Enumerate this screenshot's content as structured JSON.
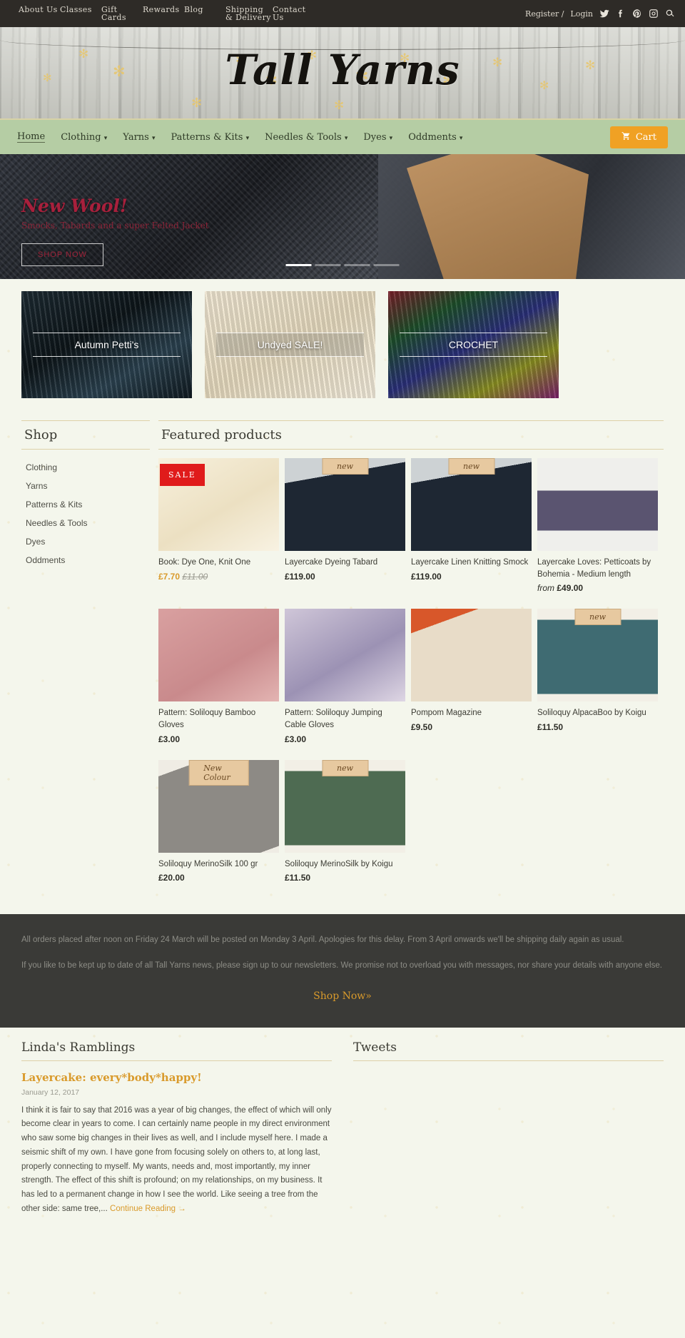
{
  "topbar": {
    "nav": [
      {
        "label": "About Us"
      },
      {
        "label": "Classes"
      },
      {
        "label": "Gift Cards"
      },
      {
        "label": "Rewards"
      },
      {
        "label": "Blog"
      },
      {
        "label": "Shipping & Delivery"
      },
      {
        "label": "Contact Us"
      }
    ],
    "register": "Register /",
    "login": "Login",
    "icons": [
      "twitter-icon",
      "facebook-icon",
      "pinterest-icon",
      "instagram-icon",
      "search-icon"
    ]
  },
  "brand": {
    "name": "Tall Yarns"
  },
  "mainnav": {
    "items": [
      {
        "label": "Home",
        "caret": false,
        "active": true
      },
      {
        "label": "Clothing",
        "caret": true
      },
      {
        "label": "Yarns",
        "caret": true
      },
      {
        "label": "Patterns & Kits",
        "caret": true
      },
      {
        "label": "Needles & Tools",
        "caret": true
      },
      {
        "label": "Dyes",
        "caret": true
      },
      {
        "label": "Oddments",
        "caret": true
      }
    ],
    "cart": "Cart"
  },
  "hero": {
    "title": "New Wool!",
    "subtitle": "Smocks, Tabards and a super Felted Jacket",
    "button": "SHOP NOW",
    "slides": 4,
    "active_slide": 1
  },
  "tiles": [
    {
      "label": "Autumn Petti's"
    },
    {
      "label": "Undyed SALE!"
    },
    {
      "label": "CROCHET"
    }
  ],
  "sidebar": {
    "title": "Shop",
    "items": [
      {
        "label": "Clothing"
      },
      {
        "label": "Yarns"
      },
      {
        "label": "Patterns & Kits"
      },
      {
        "label": "Needles & Tools"
      },
      {
        "label": "Dyes"
      },
      {
        "label": "Oddments"
      }
    ]
  },
  "featured": {
    "title": "Featured products",
    "products": [
      {
        "name": "Book: Dye One, Knit One",
        "price": "£7.70",
        "old_price": "£11.00",
        "badge": "SALE",
        "tone": "cream"
      },
      {
        "name": "Layercake Dyeing Tabard",
        "price": "£119.00",
        "badge": "new",
        "tone": "navy"
      },
      {
        "name": "Layercake Linen Knitting Smock",
        "price": "£119.00",
        "badge": "new",
        "tone": "navy"
      },
      {
        "name": "Layercake Loves: Petticoats by Bohemia - Medium length",
        "price": "£49.00",
        "price_prefix": "from",
        "tone": "skirt"
      },
      {
        "name": "Pattern: Soliloquy Bamboo Gloves",
        "price": "£3.00",
        "tone": "pink"
      },
      {
        "name": "Pattern: Soliloquy Jumping Cable Gloves",
        "price": "£3.00",
        "tone": "lilac"
      },
      {
        "name": "Pompom Magazine",
        "price": "£9.50",
        "tone": "mag"
      },
      {
        "name": "Soliloquy AlpacaBoo by Koigu",
        "price": "£11.50",
        "badge": "new",
        "tone": "teal"
      },
      {
        "name": "Soliloquy MerinoSilk 100 gr",
        "price": "£20.00",
        "badge": "New Colour",
        "tone": "grey"
      },
      {
        "name": "Soliloquy MerinoSilk by Koigu",
        "price": "£11.50",
        "badge": "new",
        "tone": "green"
      }
    ]
  },
  "promo": {
    "line1": "All orders placed after noon on Friday 24 March will be posted on Monday 3 April. Apologies for this delay. From 3 April onwards we'll be shipping daily again as usual.",
    "line2": "If you like to be kept up to date of all Tall Yarns news, please sign up to our newsletters. We promise not to overload you with messages, nor share your details with anyone else.",
    "cta": "Shop Now»"
  },
  "footer": {
    "blog_heading": "Linda's Ramblings",
    "tweets_heading": "Tweets",
    "post_title": "Layercake: every*body*happy!",
    "post_date": "January 12, 2017",
    "post_body": "I think it is fair to say that 2016 was a year of big changes, the effect of which will only become clear in years to come. I can certainly name people in my direct environment who saw some big changes in their lives as well, and I include myself here. I made a seismic shift of my own. I have gone from focusing solely on others to, at long last, properly connecting to myself. My wants, needs and, most importantly, my inner strength. The effect of this shift is profound; on my relationships, on my business. It has led to a permanent change in how I see the world. Like seeing a tree from the other side: same tree,...",
    "post_more": "Continue Reading →"
  }
}
